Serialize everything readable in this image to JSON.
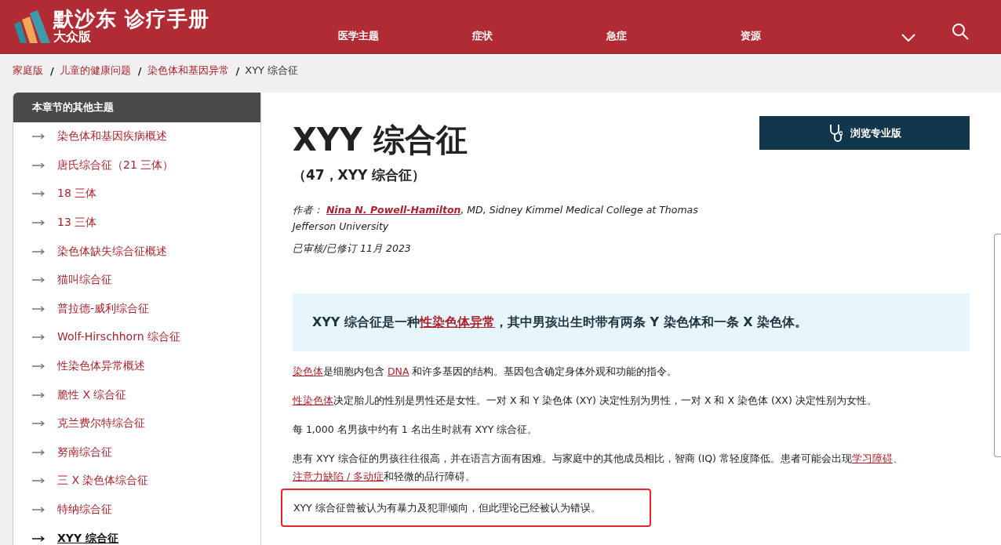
{
  "header": {
    "brand": "默沙东 诊疗手册",
    "edition": "大众版",
    "nav": [
      "医学主题",
      "症状",
      "急症",
      "资源"
    ]
  },
  "breadcrumb": [
    {
      "text": "家庭版",
      "link": true
    },
    {
      "sep": "/",
      "text": "儿童的健康问题",
      "link": true
    },
    {
      "sep": "/",
      "text": "染色体和基因异常",
      "link": true
    },
    {
      "sep": "/",
      "text": "XYY 综合征",
      "link": false
    }
  ],
  "sidebar": {
    "title": "本章节的其他主题",
    "items": [
      {
        "label": "染色体和基因疾病概述",
        "selected": false
      },
      {
        "label": "唐氏综合征（21 三体）",
        "selected": false
      },
      {
        "label": "18 三体",
        "selected": false
      },
      {
        "label": "13 三体",
        "selected": false
      },
      {
        "label": "染色体缺失综合征概述",
        "selected": false
      },
      {
        "label": "猫叫综合征",
        "selected": false
      },
      {
        "label": "普拉德-威利综合征",
        "selected": false
      },
      {
        "label": "Wolf-Hirschhorn 综合征",
        "selected": false
      },
      {
        "label": "性染色体异常概述",
        "selected": false
      },
      {
        "label": "脆性 X 综合征",
        "selected": false
      },
      {
        "label": "克兰费尔特综合征",
        "selected": false
      },
      {
        "label": "努南综合征",
        "selected": false
      },
      {
        "label": "三 X 染色体综合征",
        "selected": false
      },
      {
        "label": "特纳综合征",
        "selected": false
      },
      {
        "label": "XYY 综合征",
        "selected": true
      }
    ]
  },
  "article": {
    "title": "XYY 综合征",
    "subtitle": "（47，XYY 综合征）",
    "author_label": "作者：",
    "author": "Nina N. Powell-Hamilton",
    "affiliation": ", MD, Sidney Kimmel Medical College at Thomas Jefferson University",
    "reviewed": "已审核/已修订 11月 2023",
    "pro_button": "浏览专业版",
    "summary": [
      {
        "text": "XYY 综合征是一种",
        "link": false
      },
      {
        "text": "性染色体异常",
        "link": true
      },
      {
        "text": "，其中男孩出生时带有两条 Y 染色体和一条 X 染色体。",
        "link": false
      }
    ],
    "paragraphs": [
      {
        "highlighted": false,
        "parts": [
          {
            "text": "染色体",
            "link": true
          },
          {
            "text": "是细胞内包含 ",
            "link": false
          },
          {
            "text": "DNA",
            "link": true
          },
          {
            "text": " 和许多基因的结构。基因包含确定身体外观和功能的指令。",
            "link": false
          }
        ]
      },
      {
        "highlighted": false,
        "parts": [
          {
            "text": "性染色体",
            "link": true
          },
          {
            "text": "决定胎儿的性别是男性还是女性。一对 X 和 Y 染色体 (XY) 决定性别为男性，一对 X 和 X 染色体 (XX) 决定性别为女性。",
            "link": false
          }
        ]
      },
      {
        "highlighted": false,
        "parts": [
          {
            "text": "每 1,000 名男孩中约有 1 名出生时就有 XYY 综合征。",
            "link": false
          }
        ]
      },
      {
        "highlighted": false,
        "parts": [
          {
            "text": "患有 XYY 综合征的男孩往往很高，并在语言方面有困难。与家庭中的其他成员相比，智商 (IQ) 常轻度降低。患者可能会出现",
            "link": false
          },
          {
            "text": "学习障碍",
            "link": true
          },
          {
            "text": "、",
            "link": false
          },
          {
            "text": "注意力缺陷 / 多动症",
            "link": true
          },
          {
            "text": "和轻微的品行障碍。",
            "link": false
          }
        ]
      },
      {
        "highlighted": true,
        "parts": [
          {
            "text": "XYY 综合征曾被认为有暴力及犯罪倾向，但此理论已经被认为错误。",
            "link": false
          }
        ]
      }
    ]
  }
}
